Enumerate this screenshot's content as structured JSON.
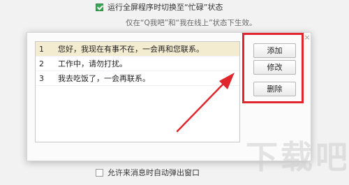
{
  "top_option": {
    "label": "运行全屏程序时切换至“忙碌”状态",
    "checked": true
  },
  "hint": "仅在“Q我吧”和“我在线上”状态下生效。",
  "messages": [
    {
      "num": "1",
      "text": "您好，我现在有事不在，一会再和您联系。"
    },
    {
      "num": "2",
      "text": "工作中，请勿打扰。"
    },
    {
      "num": "3",
      "text": "我去吃饭了，一会再联系。"
    }
  ],
  "buttons": {
    "add": "添加",
    "edit": "修改",
    "delete": "删除"
  },
  "close_symbol": "×",
  "bottom_option": {
    "label": "允许来消息时自动弹出窗口",
    "checked": false
  },
  "watermark": "下载吧",
  "colors": {
    "highlight": "#e0262c",
    "selected_row": "#f4ecd0",
    "checkbox_checked": "#3aa655"
  }
}
